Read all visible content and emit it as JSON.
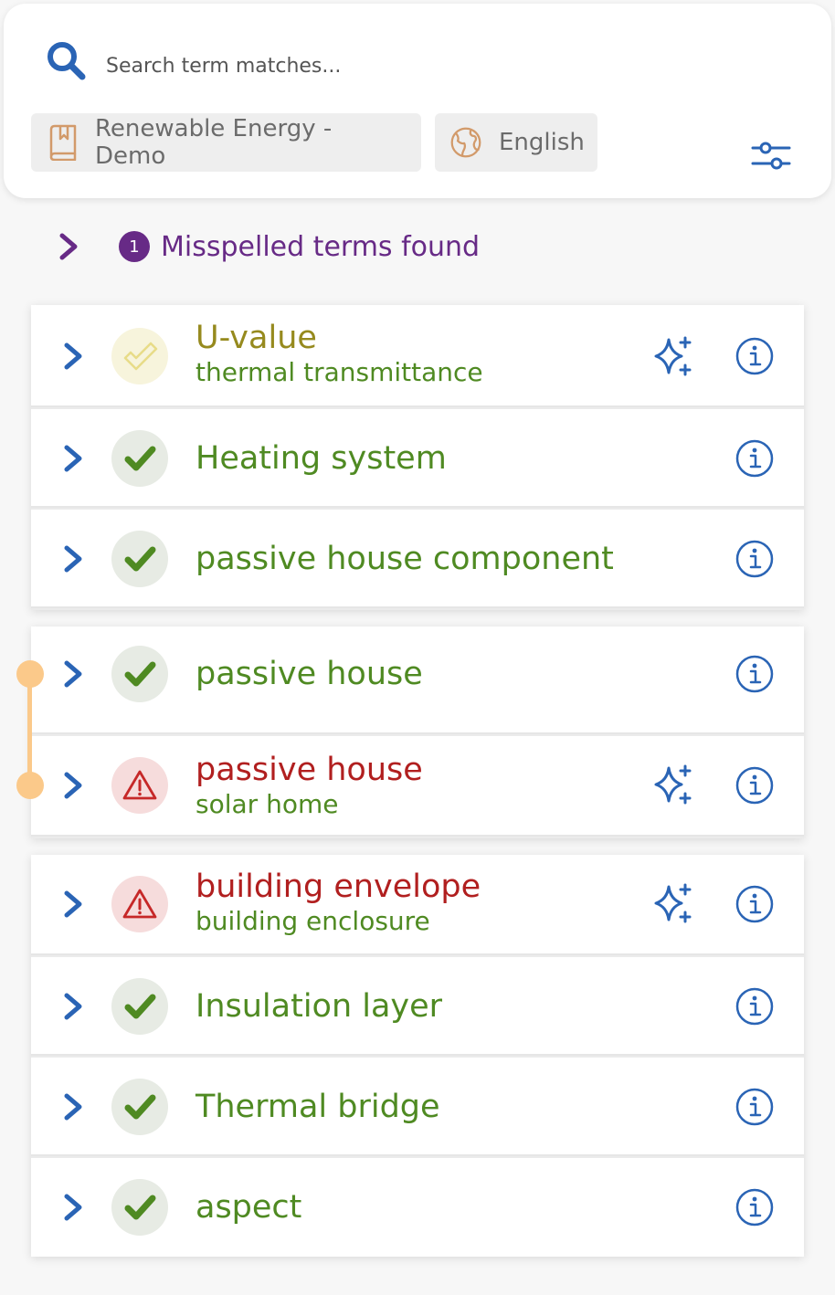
{
  "search": {
    "placeholder": "Search term matches..."
  },
  "filters": {
    "glossary": "Renewable Energy - Demo",
    "language": "English"
  },
  "misspelled": {
    "count": "1",
    "label": "Misspelled terms found"
  },
  "colors": {
    "brand_blue": "#2a64b5",
    "ok_green": "#4f8a22",
    "warn_red": "#b11f1f",
    "pending_olive": "#968a1e",
    "misspelled_purple": "#672a86",
    "connector_orange": "#fbc98a"
  },
  "terms": [
    {
      "title": "U-value",
      "subtitle": "thermal transmittance",
      "status": "pending",
      "suggestion": true
    },
    {
      "title": "Heating system",
      "subtitle": "",
      "status": "ok",
      "suggestion": false
    },
    {
      "title": "passive house component",
      "subtitle": "",
      "status": "ok",
      "suggestion": false
    },
    {
      "title": "passive house",
      "subtitle": "",
      "status": "ok",
      "suggestion": false
    },
    {
      "title": "passive house",
      "subtitle": "solar home",
      "status": "warn",
      "suggestion": true
    },
    {
      "title": "building envelope",
      "subtitle": "building enclosure",
      "status": "warn",
      "suggestion": true
    },
    {
      "title": "Insulation layer",
      "subtitle": "",
      "status": "ok",
      "suggestion": false
    },
    {
      "title": "Thermal bridge",
      "subtitle": "",
      "status": "ok",
      "suggestion": false
    },
    {
      "title": "aspect",
      "subtitle": "",
      "status": "ok",
      "suggestion": false
    }
  ]
}
